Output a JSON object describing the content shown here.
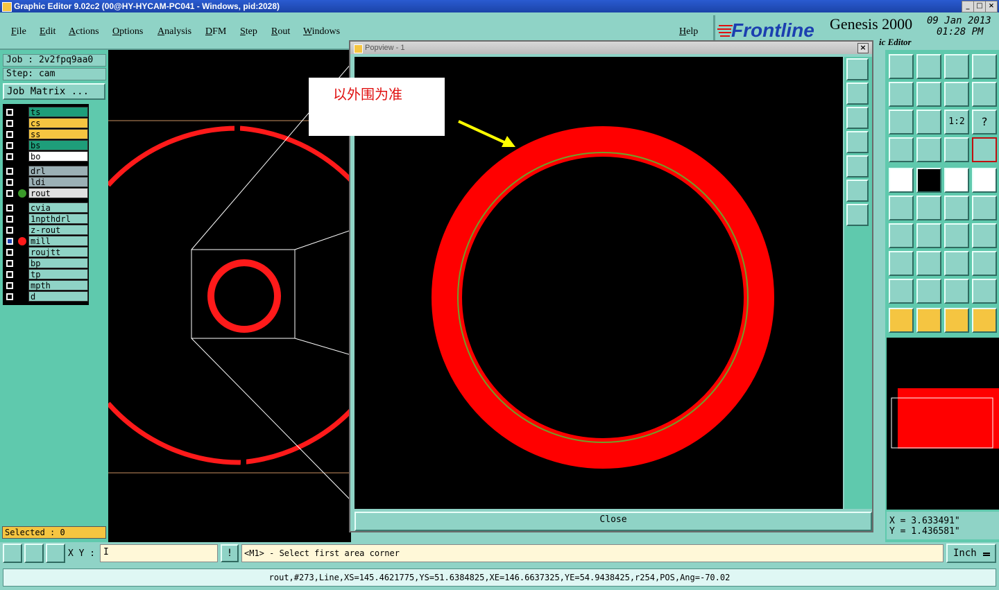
{
  "window": {
    "title": "Graphic Editor 9.02c2 (00@HY-HYCAM-PC041 - Windows, pid:2028)"
  },
  "menu": [
    "File",
    "Edit",
    "Actions",
    "Options",
    "Analysis",
    "DFM",
    "Step",
    "Rout",
    "Windows"
  ],
  "help": "Help",
  "brand": {
    "logo": "Frontline",
    "product": "Genesis 2000",
    "date": "09 Jan 2013",
    "time": "01:28 PM",
    "subtitle": "Graphic Editor",
    "subtitle_visible": "ic Editor"
  },
  "job": {
    "job_label": "Job : 2v2fpq9aa0",
    "step_label": "Step: cam",
    "matrix_button": "Job Matrix ..."
  },
  "layers_group1": [
    {
      "name": "ts",
      "color": "#1e9e7a"
    },
    {
      "name": "cs",
      "color": "#f5c541"
    },
    {
      "name": "ss",
      "color": "#f5c541"
    },
    {
      "name": "bs",
      "color": "#1e9e7a"
    },
    {
      "name": "bo",
      "color": "#ffffff"
    }
  ],
  "layers_group2": [
    {
      "name": "drl",
      "color": "#9bb0b5"
    },
    {
      "name": "ldi",
      "color": "#9bb0b5"
    },
    {
      "name": "rout",
      "color": "#e0e0e0"
    }
  ],
  "layers_group3": [
    {
      "name": "cvia",
      "color": "#8fd3c6"
    },
    {
      "name": "1npthdrl",
      "color": "#8fd3c6"
    },
    {
      "name": "z-rout",
      "color": "#8fd3c6"
    },
    {
      "name": "mill",
      "color": "#8fd3c6"
    },
    {
      "name": "roujtt",
      "color": "#8fd3c6"
    },
    {
      "name": "bp",
      "color": "#8fd3c6"
    },
    {
      "name": "tp",
      "color": "#8fd3c6"
    },
    {
      "name": "mpth",
      "color": "#8fd3c6"
    },
    {
      "name": "d",
      "color": "#8fd3c6"
    }
  ],
  "selected": "Selected : 0",
  "popview": {
    "title": "Popview - 1",
    "note": "以外围为准",
    "close_label": "Close"
  },
  "coords": {
    "x": "X = 3.633491\"",
    "y": "Y = 1.436581\""
  },
  "input": {
    "xy_label": "X Y :",
    "value": "I",
    "prompt": "<M1> - Select first area corner",
    "units": "Inch"
  },
  "status": "rout,#273,Line,XS=145.4621775,YS=51.6384825,XE=146.6637325,YE=54.9438425,r254,POS,Ang=-70.02",
  "colors": {
    "accent": "#8fd3c6",
    "panel": "#5fc9ad",
    "highlight": "#f5c541",
    "feature_red": "#ff0000"
  }
}
